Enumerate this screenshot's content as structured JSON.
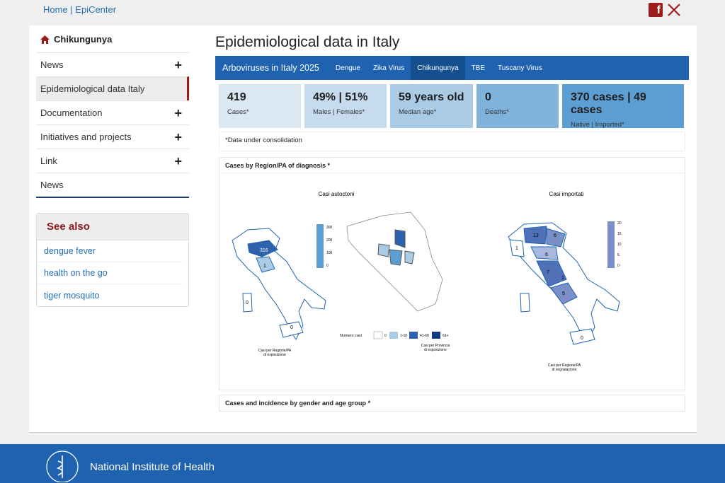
{
  "breadcrumb": "Home | EpiCenter",
  "sidebar": {
    "title": "Chikungunya",
    "items": [
      {
        "label": "News",
        "expandable": true
      },
      {
        "label": "Epidemiological data Italy",
        "expandable": false
      },
      {
        "label": "Documentation",
        "expandable": true
      },
      {
        "label": "Initiatives and projects",
        "expandable": true
      },
      {
        "label": "Link",
        "expandable": true
      },
      {
        "label": "News",
        "expandable": false
      }
    ],
    "see_also": {
      "title": "See also",
      "links": [
        "dengue fever",
        "health on the go",
        "tiger mosquito"
      ]
    }
  },
  "main": {
    "title": "Epidemiological data in Italy",
    "tabs_lead": "Arboviruses in Italy 2025",
    "tabs": [
      "Dengue",
      "Zika Virus",
      "Chikungunya",
      "TBE",
      "Tuscany Virus"
    ],
    "active_tab": "Chikungunya",
    "cards": [
      {
        "value": "419",
        "label": "Cases*",
        "color": "#dbe7f3"
      },
      {
        "value": "49% | 51%",
        "label": "Males | Females*",
        "color": "#c7dbee"
      },
      {
        "value": "59 years old",
        "label": "Median age*",
        "color": "#a9cbe6"
      },
      {
        "value": "0",
        "label": "Deaths*",
        "color": "#7fb3dc"
      },
      {
        "value": "370 cases | 49 cases",
        "label": "Native | Imported*",
        "color": "#5d9ed2"
      }
    ],
    "note": "*Data under consolidation",
    "panel1_title": "Cases by Region/PA of diagnosis",
    "panel1_asterisk": "*",
    "panel2_title": "Cases and incidence by gender and age group",
    "panel2_asterisk": "*",
    "maps": {
      "left_title": "Casi autoctoni",
      "right_title": "Casi importati",
      "left_caption_1": "Casi per Regione/PA",
      "left_caption_2": "di esposizione",
      "mid_caption_1": "Casi per Provincia",
      "mid_caption_2": "di esposizione",
      "right_caption_1": "Casi per Regione/PA",
      "right_caption_2": "di segnalazione",
      "legend_title": "Numero casi",
      "legend_items": [
        "0",
        "1-10",
        "41-60",
        "61+"
      ],
      "left_scale": [
        "300",
        "200",
        "100",
        "0"
      ],
      "right_scale": [
        "20",
        "15",
        "10",
        "5",
        "0"
      ],
      "left_values": [
        "316",
        "1",
        "0",
        "0"
      ],
      "right_values": [
        "13",
        "6",
        "1",
        "6",
        "7",
        "1",
        "5",
        "0"
      ]
    }
  },
  "footer": {
    "org": "National Institute of Health"
  }
}
